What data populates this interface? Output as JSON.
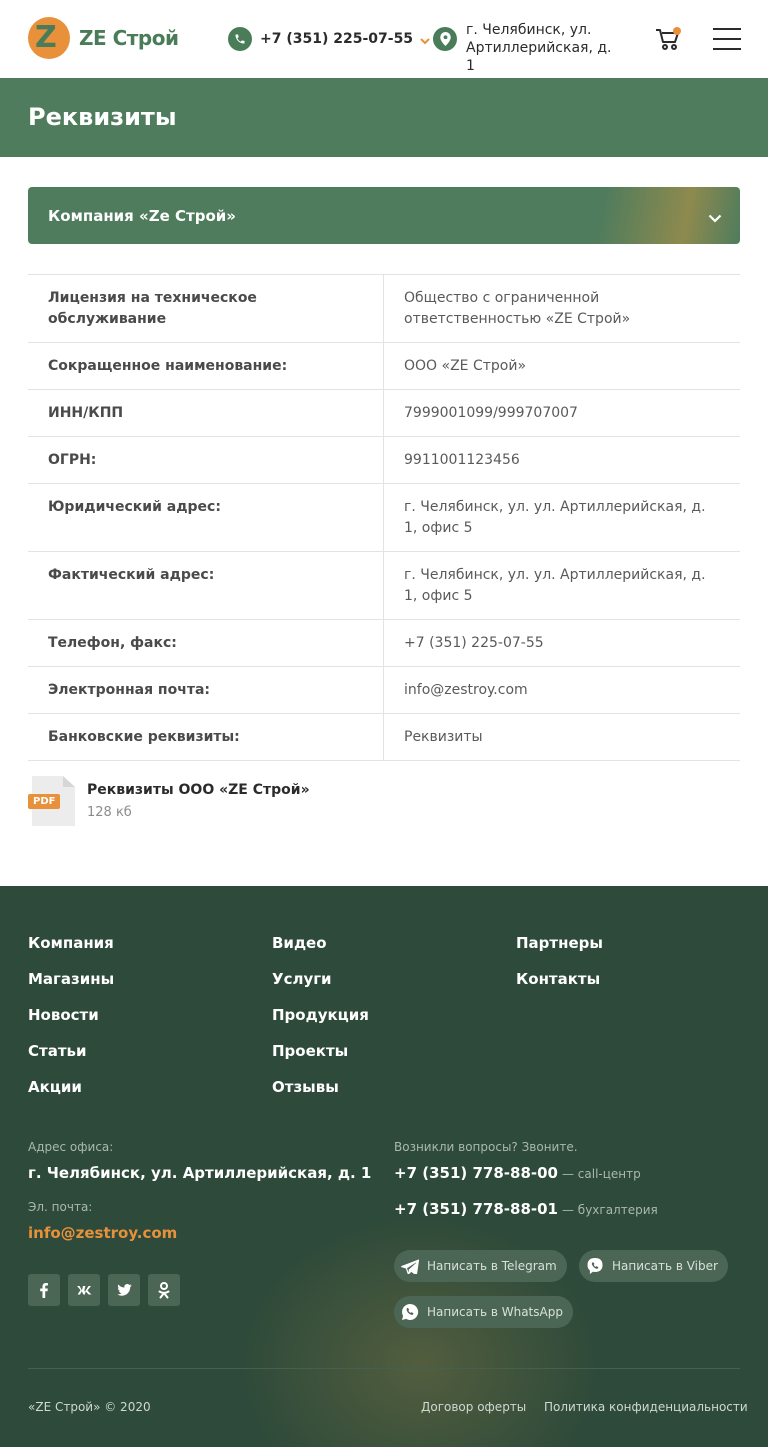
{
  "header": {
    "logo_text": "ZE Строй",
    "logo_letter": "Z",
    "phone": "+7 (351) 225-07-55",
    "address": "г. Челябинск, ул. Артиллерийская, д. 1",
    "icons": [
      "phone-icon",
      "chevron-down-icon",
      "map-pin-icon",
      "cart-icon",
      "menu-icon"
    ]
  },
  "page_title": "Реквизиты",
  "accordion": {
    "label": "Компания «Ze Строй»"
  },
  "requisites": [
    {
      "key": "Лицензия на техническое обслуживание",
      "value": "Общество с ограниченной ответственностью «ZE Строй»"
    },
    {
      "key": "Сокращенное наименование:",
      "value": "ООО «ZE Строй»"
    },
    {
      "key": "ИНН/КПП",
      "value": "7999001099/999707007"
    },
    {
      "key": "ОГРН:",
      "value": "9911001123456"
    },
    {
      "key": "Юридический адрес:",
      "value": "г. Челябинск, ул. ул. Артиллерийская, д. 1, офис 5"
    },
    {
      "key": "Фактический адрес:",
      "value": "г. Челябинск, ул. ул. Артиллерийская, д. 1, офис 5"
    },
    {
      "key": "Телефон, факс:",
      "value": "+7 (351) 225-07-55"
    },
    {
      "key": "Электронная почта:",
      "value": "info@zestroy.com"
    },
    {
      "key": "Банковские реквизиты:",
      "value": "Реквизиты"
    }
  ],
  "file": {
    "badge": "PDF",
    "name": "Реквизиты ООО «ZE Строй»",
    "size": "128 кб"
  },
  "footer": {
    "nav_col1": [
      "Компания",
      "Магазины",
      "Новости",
      "Статьи",
      "Акции"
    ],
    "nav_col2": [
      "Видео",
      "Услуги",
      "Продукция",
      "Проекты",
      "Отзывы"
    ],
    "nav_col3": [
      "Партнеры",
      "Контакты"
    ],
    "office_label": "Адрес офиса:",
    "office_value": "г. Челябинск, ул. Артиллерийская, д. 1",
    "email_label": "Эл. почта:",
    "email_value": "info@zestroy.com",
    "questions_label": "Возникли вопросы? Звоните.",
    "phone1": "+7 (351) 778-88-00",
    "phone1_note": "— call-центр",
    "phone2": "+7 (351) 778-88-01",
    "phone2_note": "— бухгалтерия",
    "telegram": "Написать в Telegram",
    "viber": "Написать в Viber",
    "whatsapp": "Написать в WhatsApp",
    "copyright": "«ZE Строй» © 2020",
    "offer": "Договор оферты",
    "privacy": "Политика конфиденциальности",
    "social_icons": [
      "facebook-icon",
      "vk-icon",
      "twitter-icon",
      "odnoklassniki-icon"
    ]
  },
  "colors": {
    "brand_green": "#4f7c5d",
    "accent_orange": "#e8913a",
    "footer_bg": "#2e4a3a"
  }
}
